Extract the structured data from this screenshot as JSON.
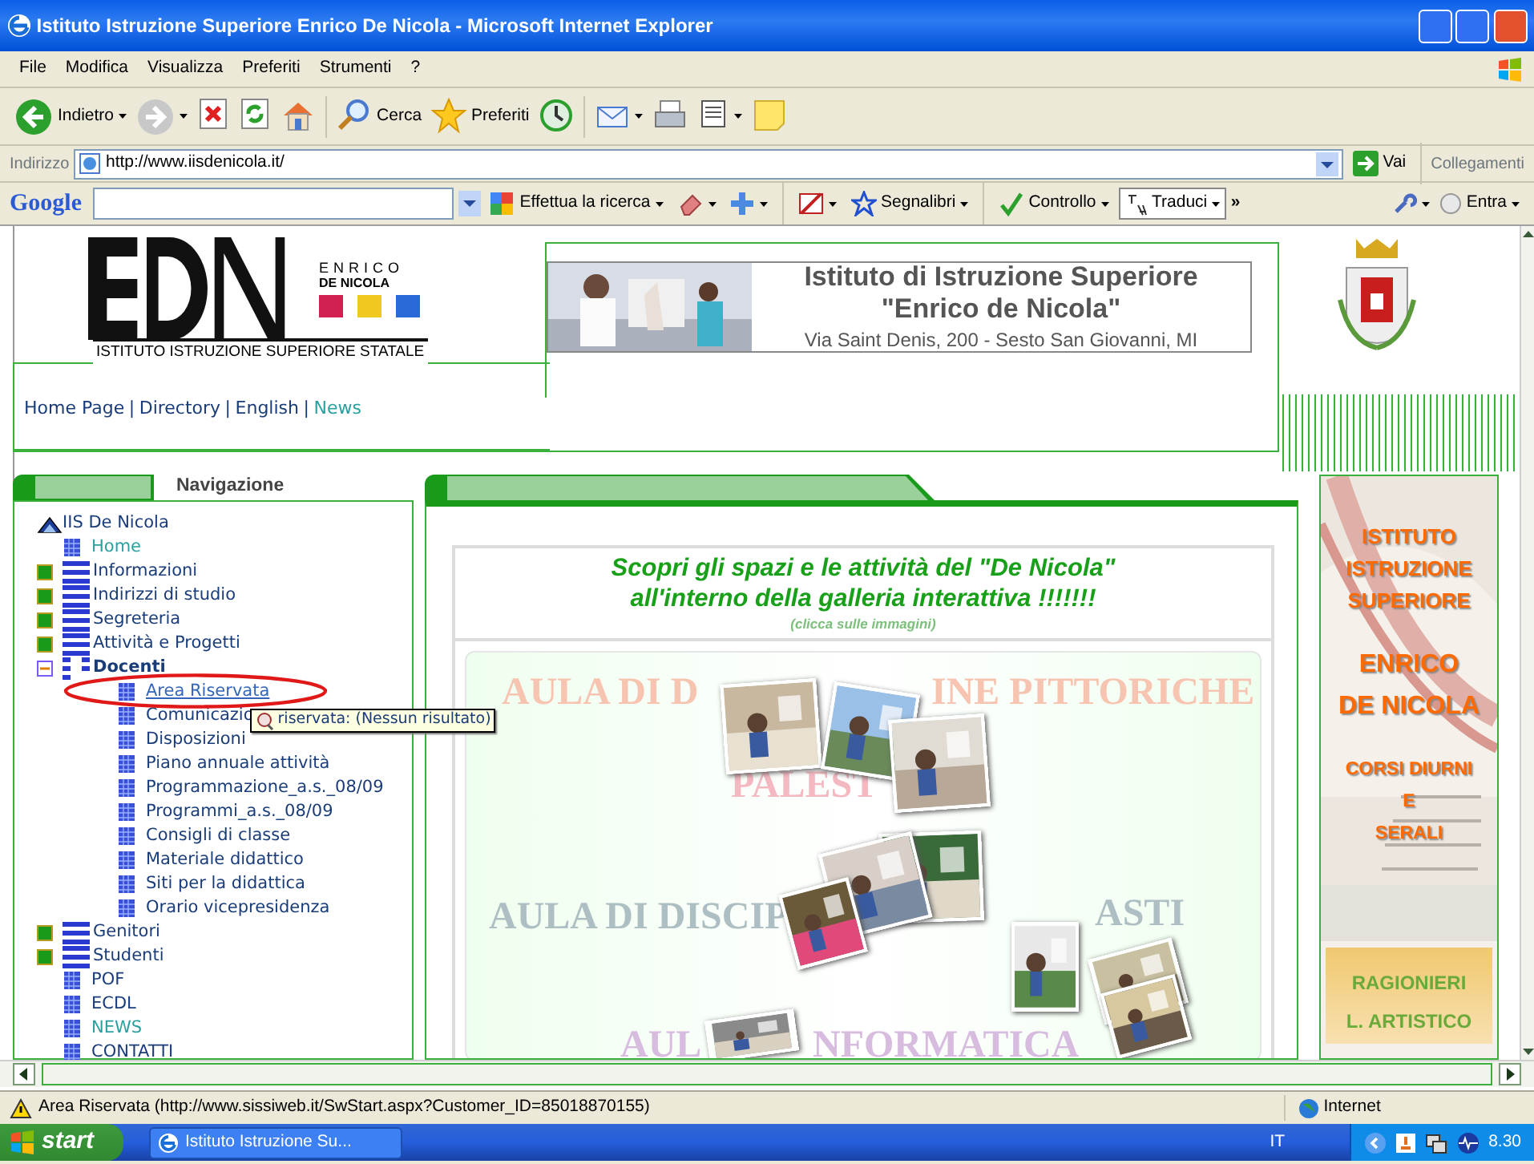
{
  "window": {
    "title": "Istituto Istruzione Superiore Enrico De Nicola - Microsoft Internet Explorer"
  },
  "menu": [
    "File",
    "Modifica",
    "Visualizza",
    "Preferiti",
    "Strumenti",
    "?"
  ],
  "toolbar": [
    {
      "kind": "back",
      "label": "Indietro"
    },
    {
      "kind": "forward"
    },
    {
      "kind": "stop"
    },
    {
      "kind": "refresh"
    },
    {
      "kind": "home"
    },
    {
      "kind": "search",
      "label": "Cerca"
    },
    {
      "kind": "favorites",
      "label": "Preferiti"
    },
    {
      "kind": "history"
    },
    {
      "kind": "mail"
    },
    {
      "kind": "print"
    },
    {
      "kind": "edit"
    },
    {
      "kind": "note"
    }
  ],
  "address_bar": {
    "label": "Indirizzo",
    "value": "http://www.iisdenicola.it/",
    "go": "Vai",
    "links": "Collegamenti"
  },
  "google_bar": {
    "logo": "Google",
    "search": "Effettua la ricerca",
    "bookmarks": "Segnalibri",
    "spellcheck": "Controllo",
    "translate": "Traduci",
    "more": "»",
    "sign_in": "Entra"
  },
  "header": {
    "logo": {
      "line_1": "ENRICO",
      "line_2": "DE NICOLA",
      "caption": "ISTITUTO ISTRUZIONE SUPERIORE STATALE"
    },
    "banner": {
      "title": "Istituto di Istruzione Superiore",
      "subtitle": "\"Enrico de Nicola\"",
      "address": "Via Saint Denis, 200 - Sesto San Giovanni, MI"
    },
    "links": [
      {
        "kind": "link",
        "label": "Home Page",
        "visited": false
      },
      {
        "kind": "separator",
        "label": "|"
      },
      {
        "kind": "link",
        "label": "Directory",
        "visited": false
      },
      {
        "kind": "separator",
        "label": "|"
      },
      {
        "kind": "link",
        "label": "English",
        "visited": false
      },
      {
        "kind": "separator",
        "label": "|"
      },
      {
        "kind": "link",
        "label": "News",
        "visited": true
      }
    ]
  },
  "nav": {
    "title": "Navigazione",
    "root": "IIS De Nicola",
    "items": [
      {
        "kind": "page",
        "label": "Home",
        "visited": true,
        "hovered": false
      },
      {
        "kind": "folder",
        "label": "Informazioni",
        "expanded": false
      },
      {
        "kind": "folder",
        "label": "Indirizzi di studio",
        "expanded": false
      },
      {
        "kind": "folder",
        "label": "Segreteria",
        "expanded": false
      },
      {
        "kind": "folder",
        "label": "Attività e Progetti",
        "expanded": false
      },
      {
        "kind": "folder",
        "label": "Docenti",
        "expanded": true,
        "children": [
          {
            "kind": "page",
            "label": "Area Riservata",
            "visited": false,
            "hovered": true
          },
          {
            "kind": "page",
            "label": "Comunicazio",
            "visited": false,
            "hovered": false,
            "tooltip": "riservata: (Nessun risultato)"
          },
          {
            "kind": "page",
            "label": "Disposizioni",
            "visited": false,
            "hovered": false
          },
          {
            "kind": "page",
            "label": "Piano annuale attività",
            "visited": false,
            "hovered": false
          },
          {
            "kind": "page",
            "label": "Programmazione_a.s._08/09",
            "visited": false,
            "hovered": false
          },
          {
            "kind": "page",
            "label": "Programmi_a.s._08/09",
            "visited": false,
            "hovered": false
          },
          {
            "kind": "page",
            "label": "Consigli di classe",
            "visited": false,
            "hovered": false
          },
          {
            "kind": "page",
            "label": "Materiale didattico",
            "visited": false,
            "hovered": false
          },
          {
            "kind": "page",
            "label": "Siti per la didattica",
            "visited": false,
            "hovered": false
          },
          {
            "kind": "page",
            "label": "Orario vicepresidenza",
            "visited": false,
            "hovered": false
          }
        ]
      },
      {
        "kind": "folder",
        "label": "Genitori",
        "expanded": false
      },
      {
        "kind": "folder",
        "label": "Studenti",
        "expanded": false
      },
      {
        "kind": "page",
        "label": "POF",
        "visited": false,
        "hovered": false
      },
      {
        "kind": "page",
        "label": "ECDL",
        "visited": false,
        "hovered": false
      },
      {
        "kind": "page",
        "label": "NEWS",
        "visited": true,
        "hovered": false
      },
      {
        "kind": "page",
        "label": "CONTATTI",
        "visited": false,
        "hovered": false
      }
    ]
  },
  "annotations": [
    {
      "kind": "ellipse"
    }
  ],
  "gallery": {
    "heading": [
      "Scopri gli spazi e le attività del \"De Nicola\"",
      "all'interno della galleria interattiva !!!!!!!"
    ],
    "hint": "(clicca sulle immagini)",
    "captions": [
      {
        "text": "AULA DI D",
        "color": "#f6c4b0"
      },
      {
        "text": "INE PITTORICHE",
        "color": "#f6c4b0"
      },
      {
        "text": "PALEST",
        "color": "#f4b8c0"
      },
      {
        "text": "AULA DI DISCIP",
        "color": "#aebfc4"
      },
      {
        "text": "ASTI",
        "color": "#aebfc4"
      },
      {
        "text": "AUL",
        "color": "#d8bce0"
      },
      {
        "text": "NFORMATICA",
        "color": "#d8bce0"
      }
    ]
  },
  "side_banner": {
    "groups": [
      [
        "ISTITUTO",
        "ISTRUZIONE",
        "SUPERIORE"
      ],
      [
        "ENRICO",
        "DE NICOLA"
      ],
      [
        "CORSI DIURNI",
        "E",
        "SERALI"
      ]
    ],
    "courses": [
      "RAGIONIERI",
      "L. ARTISTICO"
    ]
  },
  "status_bar": {
    "text": "Area Riservata (http://www.sissiweb.it/SwStart.aspx?Customer_ID=85018870155)",
    "zone": "Internet"
  },
  "taskbar": {
    "start": "start",
    "task": "Istituto Istruzione Su...",
    "language": "IT",
    "clock": "8.30"
  }
}
